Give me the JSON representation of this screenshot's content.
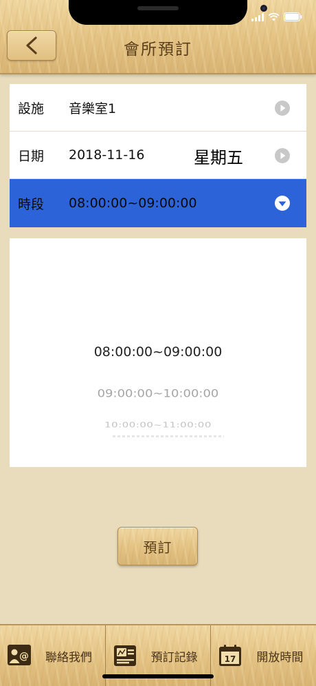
{
  "header": {
    "title": "會所預訂",
    "back_icon": "chevron-left-icon"
  },
  "form": {
    "facility": {
      "label": "設施",
      "value": "音樂室1"
    },
    "date": {
      "label": "日期",
      "value": "2018-11-16",
      "weekday": "星期五"
    },
    "timeslot": {
      "label": "時段",
      "value": "08:00:00~09:00:00"
    }
  },
  "picker": {
    "options": [
      "08:00:00~09:00:00",
      "09:00:00~10:00:00",
      "10:00:00~11:00:00"
    ],
    "selected_index": 0
  },
  "reserve_button": {
    "label": "預訂"
  },
  "tabbar": {
    "items": [
      {
        "label": "聯絡我們",
        "icon": "contact-card-icon"
      },
      {
        "label": "預訂記錄",
        "icon": "booking-record-icon"
      },
      {
        "label": "開放時間",
        "icon": "calendar-icon",
        "icon_text": "17"
      }
    ]
  },
  "colors": {
    "accent": "#2c63d8",
    "wood": "#e3c283",
    "background": "#e8dcbd",
    "title_text": "#5a3f1a"
  }
}
